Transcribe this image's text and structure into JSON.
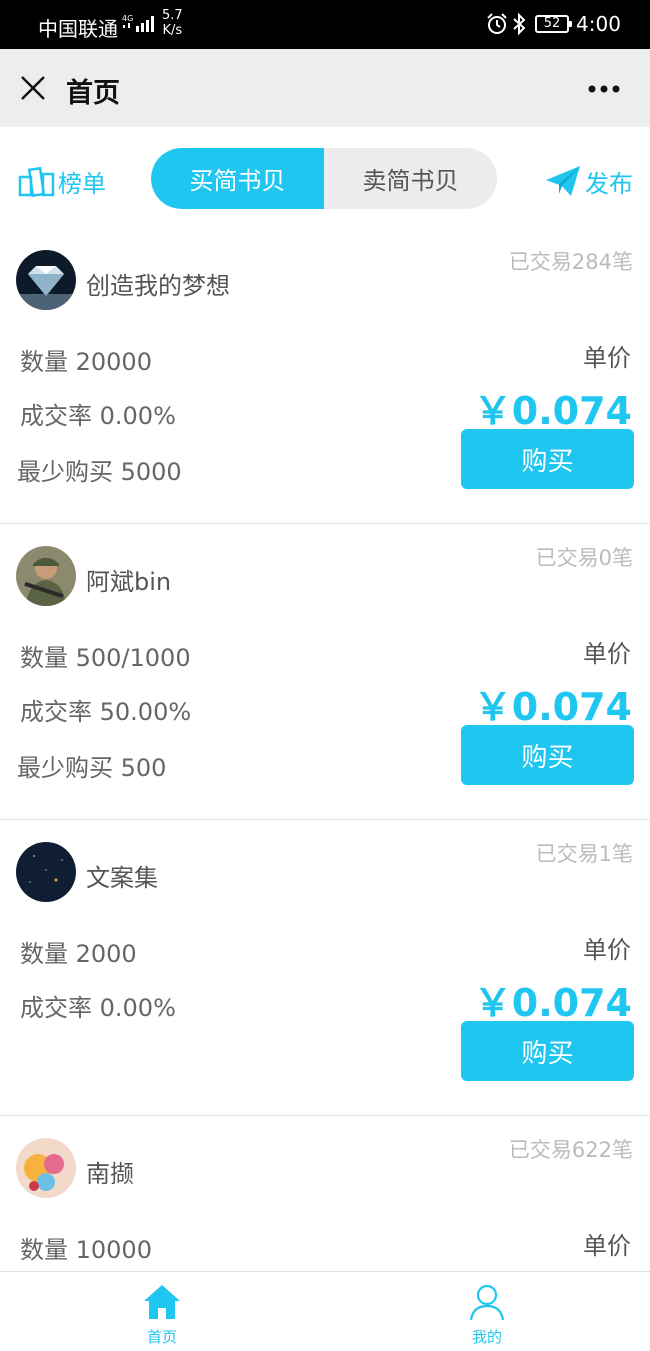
{
  "status_bar": {
    "carrier": "中国联通",
    "network": "4G",
    "speed_value": "5.7",
    "speed_unit": "K/s",
    "battery": "52",
    "time": "4:00"
  },
  "header": {
    "title": "首页"
  },
  "toolbar": {
    "rank_label": "榜单",
    "tabs": [
      {
        "label": "买简书贝",
        "active": true
      },
      {
        "label": "卖简书贝",
        "active": false
      }
    ],
    "publish_label": "发布"
  },
  "listings": [
    {
      "username": "创造我的梦想",
      "trades": "已交易284笔",
      "quantity": "数量 20000",
      "rate": "成交率 0.00%",
      "min_buy": "最少购买 5000",
      "unit_label": "单价",
      "price": "￥0.074",
      "buy_label": "购买"
    },
    {
      "username": "阿斌bin",
      "trades": "已交易0笔",
      "quantity": "数量 500/1000",
      "rate": "成交率 50.00%",
      "min_buy": "最少购买 500",
      "unit_label": "单价",
      "price": "￥0.074",
      "buy_label": "购买"
    },
    {
      "username": "文案集",
      "trades": "已交易1笔",
      "quantity": "数量 2000",
      "rate": "成交率 0.00%",
      "unit_label": "单价",
      "price": "￥0.074",
      "buy_label": "购买"
    },
    {
      "username": "南撷",
      "trades": "已交易622笔",
      "quantity": "数量 10000",
      "unit_label": "单价"
    }
  ],
  "bottom_nav": {
    "items": [
      {
        "label": "首页",
        "icon": "home-icon"
      },
      {
        "label": "我的",
        "icon": "user-icon"
      }
    ]
  },
  "colors": {
    "accent": "#1fc6f0",
    "header_bg": "#ededed",
    "muted_text": "#bbbbbb"
  }
}
